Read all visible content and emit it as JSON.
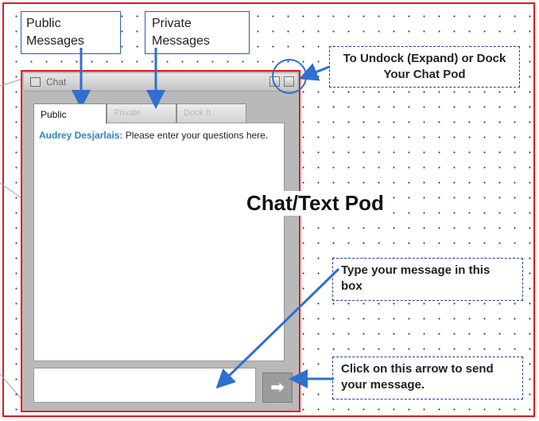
{
  "chat_pod": {
    "title": "Chat",
    "tabs": [
      {
        "label": "Public"
      },
      {
        "label": "Private"
      },
      {
        "label": "Dock It"
      }
    ],
    "message": {
      "speaker": "Audrey Desjarlais:",
      "text": " Please enter your questions here."
    },
    "send_button_glyph": "➡"
  },
  "callouts": {
    "public_messages": "Public Messages",
    "private_messages": "Private Messages",
    "undock": "To Undock (Expand) or Dock Your Chat Pod",
    "type_message": "Type your message in this box",
    "send_arrow": "Click on this arrow to send your message."
  },
  "heading": "Chat/Text Pod",
  "colors": {
    "border_red": "#e8141c",
    "callout_blue": "#2d5bbd",
    "arrow_blue": "#2f6fd0",
    "speaker_blue": "#2d86c3"
  }
}
